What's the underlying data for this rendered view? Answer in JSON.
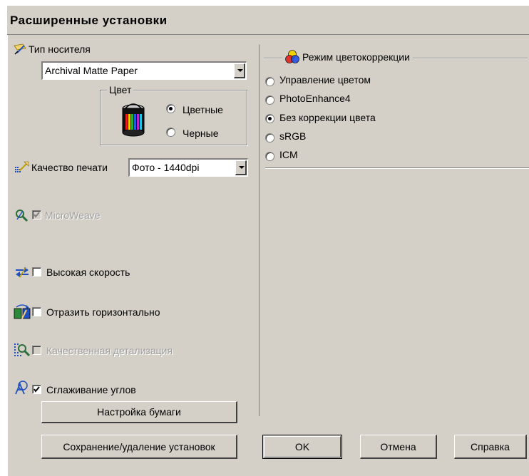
{
  "window": {
    "title": "Расширенные установки"
  },
  "media_type": {
    "label": "Тип носителя",
    "value": "Archival Matte Paper"
  },
  "color": {
    "group_label": "Цвет",
    "options": [
      {
        "label": "Цветные",
        "selected": true
      },
      {
        "label": "Черные",
        "selected": false
      }
    ]
  },
  "print_quality": {
    "label": "Качество печати",
    "value": "Фото - 1440dpi"
  },
  "checkboxes": {
    "microweave": {
      "label": "MicroWeave",
      "checked": true,
      "enabled": false
    },
    "high_speed": {
      "label": "Высокая скорость",
      "checked": false,
      "enabled": true
    },
    "flip_horizontal": {
      "label": "Отразить горизонтально",
      "checked": false,
      "enabled": true
    },
    "finest_detail": {
      "label": "Качественная детализация",
      "checked": false,
      "enabled": false
    },
    "smooth_edges": {
      "label": "Сглаживание углов",
      "checked": true,
      "enabled": true
    }
  },
  "color_management": {
    "group_label": "Режим цветокоррекции",
    "options": [
      {
        "label": "Управление цветом",
        "selected": false
      },
      {
        "label": "PhotoEnhance4",
        "selected": false
      },
      {
        "label": "Без коррекции цвета",
        "selected": true
      },
      {
        "label": "sRGB",
        "selected": false
      },
      {
        "label": "ICM",
        "selected": false
      }
    ]
  },
  "buttons": {
    "paper_config": "Настройка бумаги",
    "save_settings": "Сохранение/удаление установок",
    "ok": "OK",
    "cancel": "Отмена",
    "help": "Справка"
  },
  "colors": {
    "face": "#d4d0c8",
    "shadow": "#808080",
    "highlight": "#ffffff",
    "disabled_text": "#a0a0a0"
  }
}
